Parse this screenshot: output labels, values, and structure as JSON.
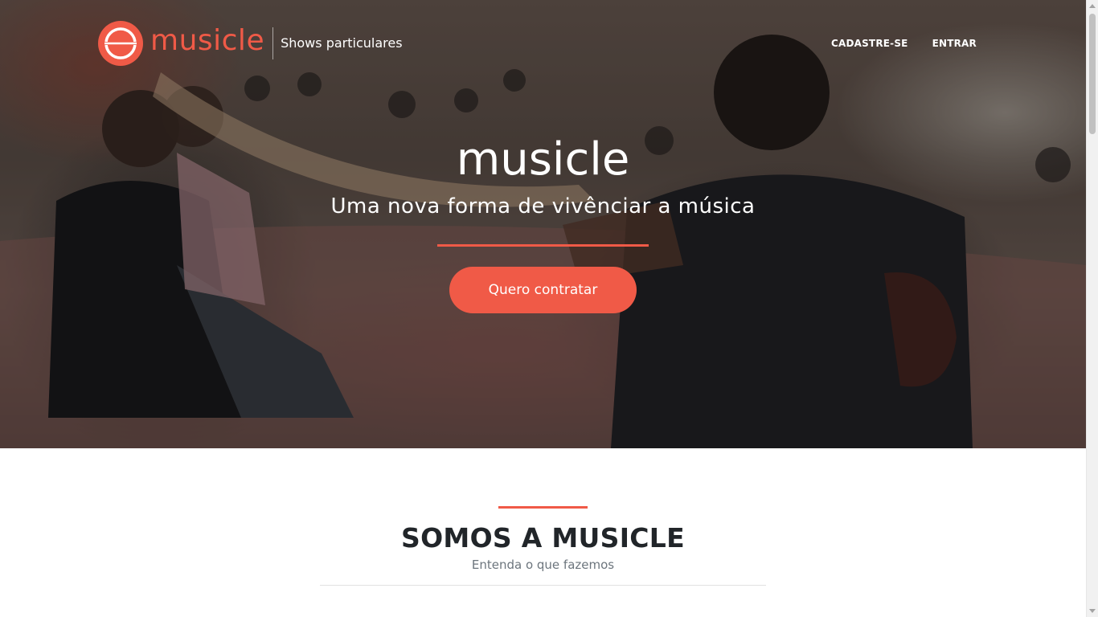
{
  "header": {
    "brand_name": "musicle",
    "tagline": "Shows particulares",
    "nav": [
      {
        "label": "CADASTRE-SE"
      },
      {
        "label": "ENTRAR"
      }
    ]
  },
  "hero": {
    "title": "musicle",
    "subtitle": "Uma nova forma de vivênciar a música",
    "cta_label": "Quero contratar",
    "background": "photo of a small acoustic concert: a guitarist playing to a seated audience on a patterned rug"
  },
  "section": {
    "title": "SOMOS A MUSICLE",
    "subtitle": "Entenda o que fazemos"
  },
  "scrollbar": {
    "position": 0.0
  },
  "colors": {
    "accent": "#f05a47",
    "text_dark": "#212529",
    "text_muted": "#6c757d"
  },
  "icons": {
    "logo": "musicle-logo-icon"
  }
}
